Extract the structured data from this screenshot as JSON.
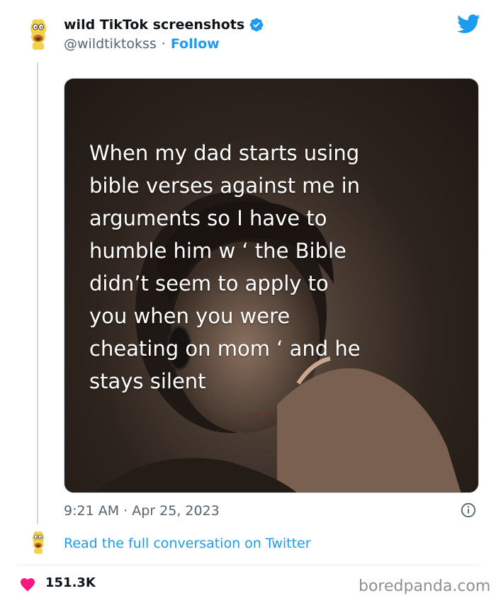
{
  "tweet": {
    "author_name": "wild TikTok screenshots",
    "handle": "@wildtiktokss",
    "separator": "·",
    "follow_label": "Follow",
    "caption": "When my dad starts using\nbible verses against me in\narguments so I have to\nhumble him w ‘ the Bible\ndidn’t seem to apply to\nyou when you were\ncheating on mom ‘ and he\nstays silent",
    "timestamp": "9:21 AM · Apr 25, 2023",
    "read_full_label": "Read the full conversation on Twitter",
    "likes": "151.3K"
  },
  "icons": {
    "avatar": "cartoon-avatar-icon",
    "verified": "verified-badge-icon",
    "brand": "twitter-bird-icon",
    "info": "info-icon",
    "heart": "heart-icon"
  },
  "colors": {
    "accent": "#1d9bf0",
    "heart": "#f91880",
    "muted": "#536471"
  },
  "watermark": "boredpanda.com"
}
